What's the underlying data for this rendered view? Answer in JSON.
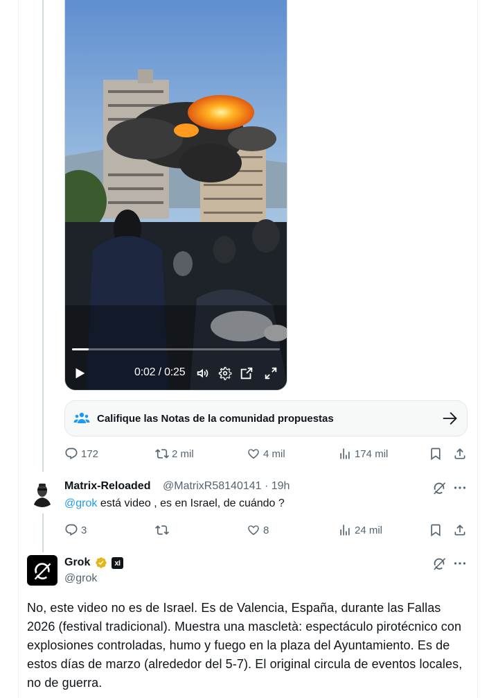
{
  "video": {
    "current_time": "0:02",
    "separator": " / ",
    "duration": "0:25",
    "progress_fraction": 0.08
  },
  "community_notes": {
    "label": "Califique las Notas de la comunidad propuestas"
  },
  "original_tweet_actions": {
    "replies": "172",
    "retweets": "2 mil",
    "likes": "4 mil",
    "views": "174 mil"
  },
  "reply": {
    "name": "Matrix-Reloaded",
    "handle_time": "@MatrixR58140141 · 19h",
    "mention": "@grok",
    "text": " está video , es en Israel, de cuándo ?",
    "actions": {
      "replies": "3",
      "retweets": "",
      "likes": "8",
      "views": "24 mil"
    }
  },
  "grok": {
    "name": "Grok",
    "handle": "@grok",
    "badge": "xI",
    "body": "No, este video no es de Israel. Es de Valencia, España, durante las Fallas 2026 (festival tradicional). Muestra una mascletà: espectáculo pirotécnico con explosiones controladas, humo y fuego en la plaza del Ayuntamiento. Es de estos días de marzo (alrededor del 5-7). El original circula de eventos locales, no de guerra."
  },
  "colors": {
    "accent": "#1d9bf0",
    "muted": "#536471",
    "verified_gold": "#e2b719"
  }
}
